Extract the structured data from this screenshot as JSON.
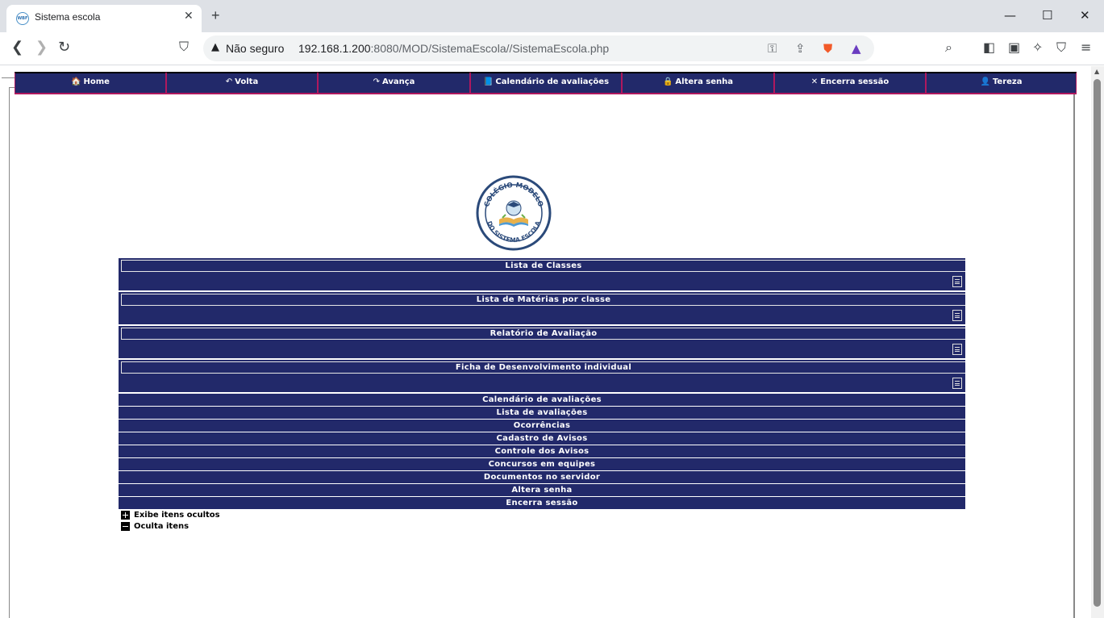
{
  "browser": {
    "tab_title": "Sistema escola",
    "favicon_text": "WBF",
    "new_tab": "+",
    "security_label": "Não seguro",
    "url_host": "192.168.1.200",
    "url_rest": ":8080/MOD/SistemaEscola//SistemaEscola.php"
  },
  "topmenu": {
    "items": [
      {
        "label": "Home",
        "icon": "house-icon"
      },
      {
        "label": "Volta",
        "icon": "undo-icon"
      },
      {
        "label": "Avança",
        "icon": "redo-icon"
      },
      {
        "label": "Calendário de avaliações",
        "icon": "calendar-icon"
      },
      {
        "label": "Altera senha",
        "icon": "lock-icon"
      },
      {
        "label": "Encerra sessão",
        "icon": "x-icon"
      },
      {
        "label": "Tereza",
        "icon": "user-icon"
      }
    ]
  },
  "logo": {
    "top_text": "COLÉGIO MODELO",
    "bottom_text": "DO SISTEMA ESCOLA"
  },
  "groups": [
    {
      "title": "Lista de Classes"
    },
    {
      "title": "Lista de Matérias por classe"
    },
    {
      "title": "Relatório de Avaliação"
    },
    {
      "title": "Ficha de Desenvolvimento individual"
    }
  ],
  "rows": [
    "Calendário de avaliações",
    "Lista de avaliações",
    "Ocorrências",
    "Cadastro de Avisos",
    "Controle dos Avisos",
    "Concursos em equipes",
    "Documentos no servidor",
    "Altera senha",
    "Encerra sessão"
  ],
  "toggles": {
    "show_hidden": "Exibe itens ocultos",
    "hide": "Oculta itens"
  },
  "colors": {
    "menu_bg": "#22296a",
    "menu_border": "#b0185e"
  }
}
